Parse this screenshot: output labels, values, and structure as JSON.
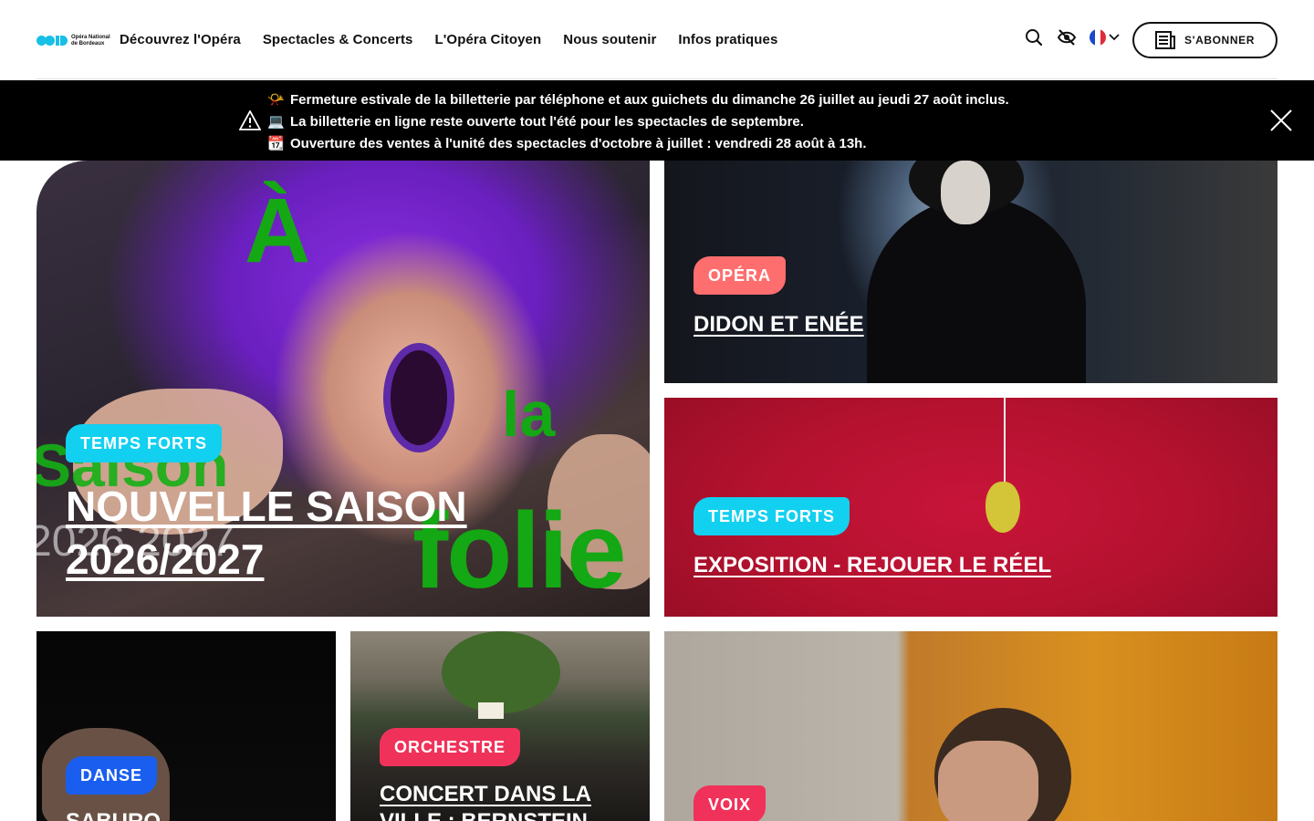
{
  "header": {
    "logo_text": "Opéra National de Bordeaux",
    "nav": [
      "Découvrez l'Opéra",
      "Spectacles & Concerts",
      "L'Opéra Citoyen",
      "Nous soutenir",
      "Infos pratiques"
    ],
    "subscribe_label": "S'ABONNER",
    "language": "fr"
  },
  "alert": {
    "lines": [
      {
        "emoji": "📯",
        "text": "Fermeture estivale de la billetterie par téléphone et aux guichets du dimanche 26 juillet au jeudi 27 août inclus."
      },
      {
        "emoji": "💻",
        "text": "La billetterie en ligne reste ouverte tout l'été pour les spectacles de septembre."
      },
      {
        "emoji": "📆",
        "text": "Ouverture des ventes à l'unité des spectacles d'octobre à juillet : vendredi 28 août à 13h."
      }
    ],
    "warning_icon": "warning-triangle-icon",
    "close_icon": "close-icon"
  },
  "cards": {
    "hero": {
      "tag": "TEMPS FORTS",
      "title_line1": "NOUVELLE SAISON",
      "title_line2": "2026/2027",
      "poster": {
        "a": "À",
        "la": "la",
        "folie": "folie",
        "saison": "Saison",
        "year": "2026 2027"
      }
    },
    "didon": {
      "tag": "OPÉRA",
      "title": "DIDON ET ENÉE"
    },
    "expo": {
      "tag": "TEMPS FORTS",
      "title": "EXPOSITION - REJOUER LE RÉEL"
    },
    "sabur": {
      "tag": "DANSE",
      "title": "SABURO"
    },
    "concert": {
      "tag": "ORCHESTRE",
      "title_line1": "CONCERT DANS LA",
      "title_line2": "VILLE : BERNSTEIN"
    },
    "voix": {
      "tag": "VOIX",
      "title": ""
    }
  },
  "colors": {
    "tag_cyan": "#12d0f0",
    "tag_coral": "#ff6e6e",
    "tag_blue": "#1a5ef0",
    "tag_pink": "#f0325a",
    "poster_green": "#14a814",
    "alert_bg": "#000000"
  }
}
